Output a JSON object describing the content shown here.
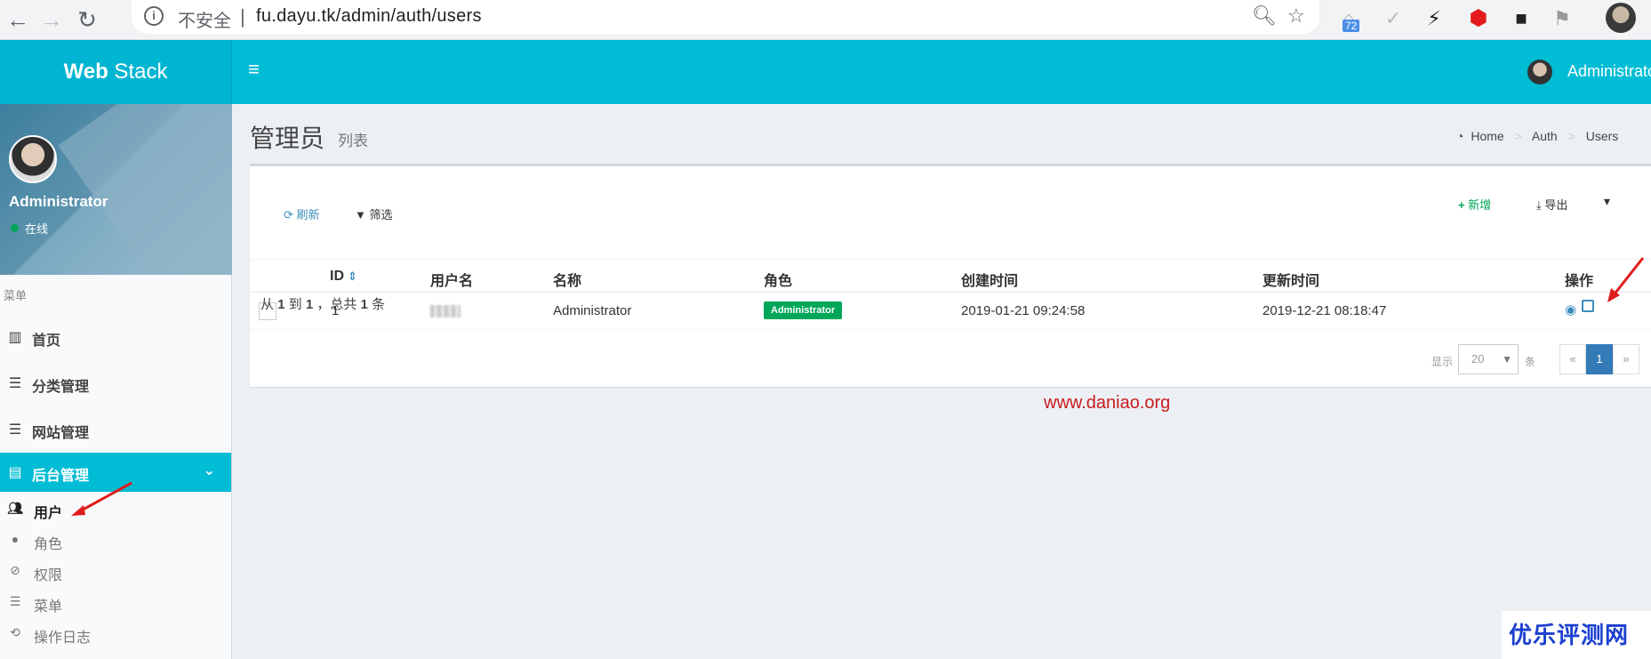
{
  "browser": {
    "insecure_label": "不安全",
    "separator": "|",
    "url": "fu.dayu.tk/admin/auth/users",
    "ext_badge": "72"
  },
  "app": {
    "logo_bold": "Web",
    "logo_rest": " Stack",
    "top_user_name": "Administrator"
  },
  "sidebar": {
    "user_name": "Administrator",
    "status": "在线",
    "menu_header": "菜单",
    "items": [
      {
        "label": "首页",
        "icon": "bar-chart-icon"
      },
      {
        "label": "分类管理",
        "icon": "bars-icon"
      },
      {
        "label": "网站管理",
        "icon": "bars-icon"
      },
      {
        "label": "后台管理",
        "icon": "tasks-icon",
        "active": true
      }
    ],
    "subitems": [
      {
        "label": "用户",
        "icon": "users-icon",
        "current": true
      },
      {
        "label": "角色",
        "icon": "user-icon"
      },
      {
        "label": "权限",
        "icon": "ban-icon"
      },
      {
        "label": "菜单",
        "icon": "bars-icon"
      },
      {
        "label": "操作日志",
        "icon": "history-icon"
      }
    ]
  },
  "header": {
    "title": "管理员",
    "subtitle": "列表",
    "breadcrumb": [
      "Home",
      "Auth",
      "Users"
    ]
  },
  "toolbar": {
    "refresh": "刷新",
    "filter": "筛选",
    "new": "新增",
    "export": "导出"
  },
  "table": {
    "columns": [
      "ID",
      "用户名",
      "名称",
      "角色",
      "创建时间",
      "更新时间",
      "操作"
    ],
    "rows": [
      {
        "id": "1",
        "name": "Administrator",
        "role": "Administrator",
        "created": "2019-01-21 09:24:58",
        "updated": "2019-12-21 08:18:47"
      }
    ]
  },
  "pagination": {
    "summary_prefix": "从 ",
    "from": "1",
    "mid": " 到 ",
    "to": "1",
    "total_prefix": " ，总共 ",
    "total": "1",
    "suffix": " 条",
    "show_label": "显示",
    "per_page": "20",
    "per_page_unit": "条",
    "prev": "«",
    "current": "1",
    "next": "»"
  },
  "watermark": "www.daniao.org",
  "corner_logo": "优乐评测网",
  "colors": {
    "accent": "#00bcd4",
    "success": "#00a65a",
    "link": "#3c8dbc",
    "annotation": "#e01c1c"
  }
}
